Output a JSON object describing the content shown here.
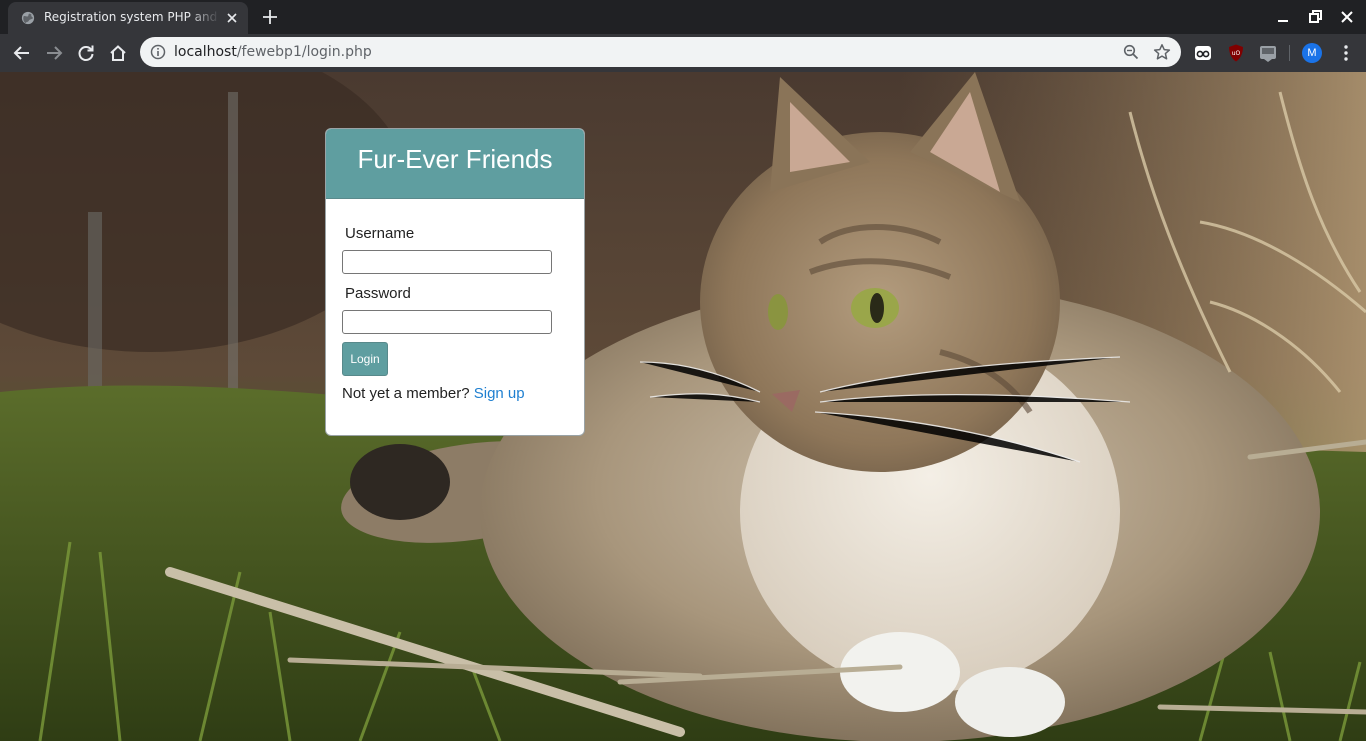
{
  "browser": {
    "tab": {
      "title": "Registration system PHP and MySQL",
      "favicon": "globe-icon"
    },
    "address_bar": {
      "host": "localhost",
      "path": "/fewebp1/login.php"
    },
    "toolbar_icons": [
      "back-arrow-icon",
      "forward-arrow-icon",
      "reload-icon",
      "home-icon",
      "site-info-icon",
      "zoom-icon",
      "bookmark-star-icon"
    ],
    "extensions": [
      "reader-glasses-icon",
      "ublock-origin-icon",
      "dsc-extension-icon"
    ],
    "profile_initial": "M",
    "window_controls": [
      "minimize-icon",
      "restore-icon",
      "close-icon"
    ]
  },
  "login_card": {
    "title": "Fur-Ever Friends",
    "username_label": "Username",
    "username_value": "",
    "password_label": "Password",
    "password_value": "",
    "login_button": "Login",
    "member_prompt": "Not yet a member?",
    "signup_link": "Sign up"
  },
  "colors": {
    "accent": "#5f9ea0",
    "link": "#1e7fd0",
    "card_background": "#ffffff",
    "browser_frame": "#202124",
    "toolbar": "#35363a"
  }
}
